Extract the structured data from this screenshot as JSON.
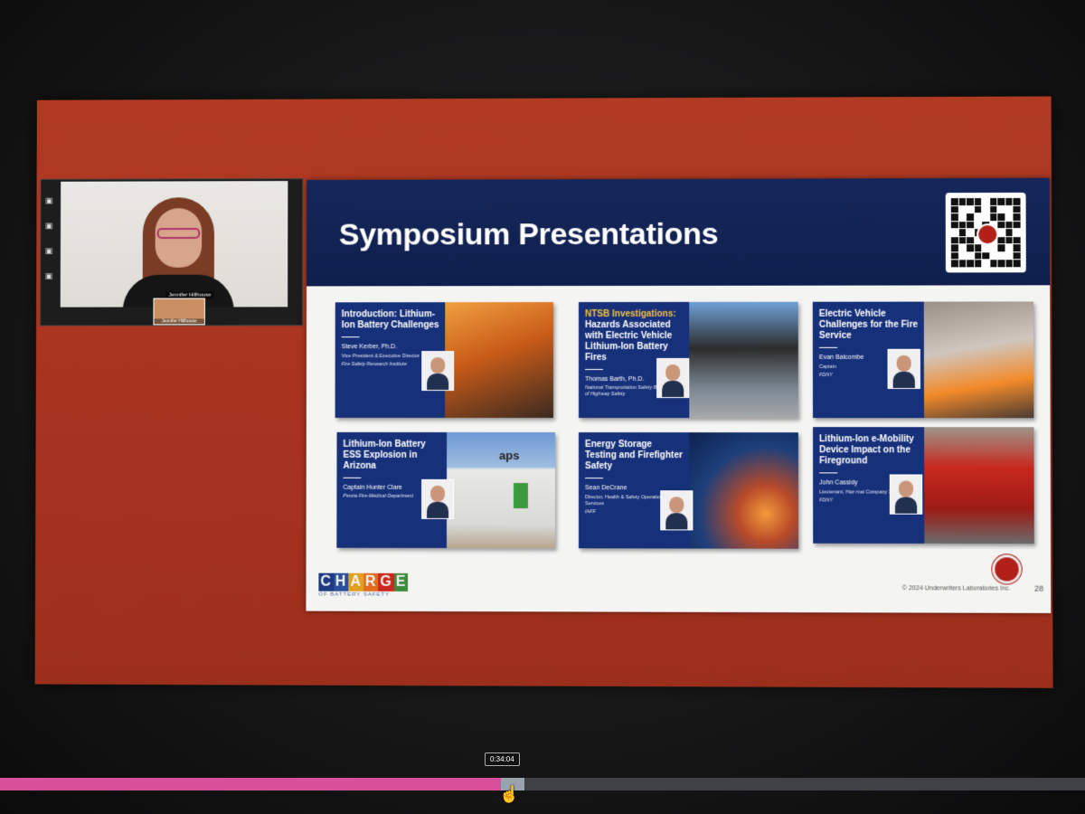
{
  "webcam": {
    "name_label": "Jennifer Hillhouse",
    "thumb_label": "Jennifer Hillhouse"
  },
  "slide": {
    "title": "Symposium Presentations",
    "page_number": "28",
    "copyright": "© 2024 Underwriters Laboratories Inc.",
    "logo_main": "CHARGE",
    "logo_sub": "OF BATTERY SAFETY",
    "cards": [
      {
        "title_accent": "",
        "title": "Introduction: Lithium-Ion Battery Challenges",
        "name": "Steve Kerber, Ph.D.",
        "role": "Vice President & Executive Director",
        "org": "Fire Safety Research Institute"
      },
      {
        "title_accent": "NTSB Investigations:",
        "title": "Hazards Associated with Electric Vehicle Lithium-Ion Battery Fires",
        "name": "Thomas Barth, Ph.D.",
        "role": "",
        "org": "National Transportation Safety Board, Office of Highway Safety"
      },
      {
        "title_accent": "",
        "title": "Electric Vehicle Challenges for the Fire Service",
        "name": "Evan Balcombe",
        "role": "Captain",
        "org": "FDNY"
      },
      {
        "title_accent": "",
        "title": "Lithium-Ion Battery ESS Explosion in Arizona",
        "name": "Captain Hunter Clare",
        "role": "",
        "org": "Peoria Fire-Medical Department"
      },
      {
        "title_accent": "",
        "title": "Energy Storage Testing and Firefighter Safety",
        "name": "Sean DeCrane",
        "role": "Director, Health & Safety Operational Services",
        "org": "IAFF"
      },
      {
        "title_accent": "",
        "title": "Lithium-Ion e-Mobility Device Impact on the Fireground",
        "name": "John Cassidy",
        "role": "Lieutenant, Haz mat Company 1",
        "org": "FDNY"
      }
    ],
    "aps_label": "aps"
  },
  "player": {
    "time": "0:34:04",
    "progress_fraction": 0.462,
    "buffer_fraction": 0.483
  },
  "colors": {
    "frame": "#a83420",
    "header": "#0f1f4d",
    "card": "#17307a",
    "progress_fill": "#d94f9a"
  }
}
